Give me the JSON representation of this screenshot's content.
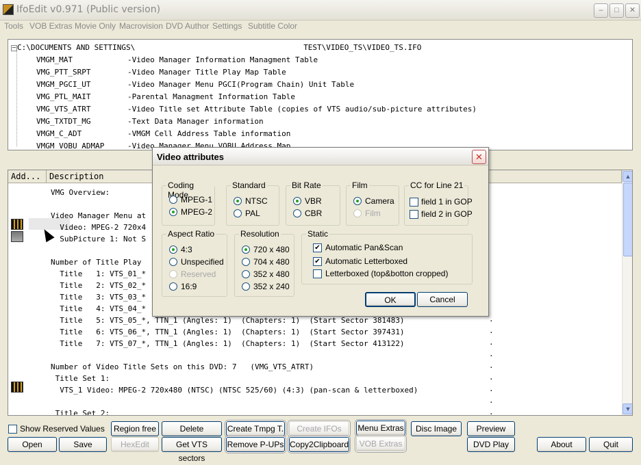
{
  "window": {
    "title": "IfoEdit v0.971 (Public version)"
  },
  "menu": [
    "Tools",
    "VOB Extras",
    "Movie Only",
    "Macrovision",
    "DVD Author",
    "Settings",
    "Subtitle Color"
  ],
  "tree": {
    "root": "C:\\DOCUMENTS AND SETTINGS\\",
    "root_suffix": "TEST\\VIDEO_TS\\VIDEO_TS.IFO",
    "items": [
      {
        "name": "VMGM_MAT",
        "desc": "-Video Manager Information Managment Table"
      },
      {
        "name": "VMG_PTT_SRPT",
        "desc": "-Video Manager Title Play Map Table"
      },
      {
        "name": "VMGM_PGCI_UT",
        "desc": "-Video Manager Menu PGCI(Program Chain) Unit Table"
      },
      {
        "name": "VMG_PTL_MAIT",
        "desc": "-Parental Managment Information Table"
      },
      {
        "name": "VMG_VTS_ATRT",
        "desc": "-Video Title set Attribute Table (copies of VTS audio/sub-picture attributes)"
      },
      {
        "name": "VMG_TXTDT_MG",
        "desc": "-Text Data Manager information"
      },
      {
        "name": "VMGM_C_ADT",
        "desc": "-VMGM Cell Address Table information"
      },
      {
        "name": "VMGM_VOBU_ADMAP",
        "desc": "-Video Manager Menu VOBU Address Map"
      }
    ]
  },
  "list": {
    "columns": [
      "Add...",
      "Description"
    ],
    "lines": [
      "VMG Overview:",
      "",
      "Video Manager Menu at",
      "  Video: MPEG-2 720x4",
      "  SubPicture 1: Not S",
      "",
      "Number of Title Play",
      "  Title   1: VTS_01_*",
      "  Title   2: VTS_02_*",
      "  Title   3: VTS_03_*",
      "  Title   4: VTS_04_*",
      "  Title   5: VTS_05_*, TTN_1 (Angles: 1)  (Chapters: 1)  (Start Sector 381483)",
      "  Title   6: VTS_06_*, TTN_1 (Angles: 1)  (Chapters: 1)  (Start Sector 397431)",
      "  Title   7: VTS_07_*, TTN_1 (Angles: 1)  (Chapters: 1)  (Start Sector 413122)",
      "",
      "Number of Video Title Sets on this DVD: 7   (VMG_VTS_ATRT)",
      " Title Set 1:",
      "  VTS_1 Video: MPEG-2 720x480 (NTSC) (NTSC 525/60) (4:3) (pan-scan & letterboxed)",
      "",
      " Title Set 2:"
    ],
    "dot": "."
  },
  "dialog": {
    "title": "Video attributes",
    "coding_mode": {
      "label": "Coding Mode",
      "options": [
        "MPEG-1",
        "MPEG-2"
      ],
      "selected": "MPEG-2"
    },
    "standard": {
      "label": "Standard",
      "options": [
        "NTSC",
        "PAL"
      ],
      "selected": "NTSC"
    },
    "bit_rate": {
      "label": "Bit Rate",
      "options": [
        "VBR",
        "CBR"
      ],
      "selected": "VBR"
    },
    "film": {
      "label": "Film",
      "options": [
        "Camera",
        "Film"
      ],
      "selected": "Camera"
    },
    "cc": {
      "label": "CC for Line 21",
      "options": [
        "field 1 in GOP",
        "field 2 in GOP"
      ]
    },
    "aspect_ratio": {
      "label": "Aspect Ratio",
      "options": [
        "4:3",
        "Unspecified",
        "Reserved",
        "16:9"
      ],
      "selected": "4:3"
    },
    "resolution": {
      "label": "Resolution",
      "options": [
        "720 x 480",
        "704 x 480",
        "352 x 480",
        "352 x 240"
      ],
      "selected": "720 x 480"
    },
    "static": {
      "label": "Static",
      "options": [
        "Automatic Pan&Scan",
        "Automatic Letterboxed",
        "Letterboxed (top&botton cropped)"
      ],
      "checked": [
        true,
        true,
        false
      ]
    },
    "ok": "OK",
    "cancel": "Cancel"
  },
  "buttons": {
    "show_reserved": "Show Reserved Values",
    "region_free": "Region free",
    "delete_playback": "Delete Playback",
    "create_tmpg": "Create Tmpg T.",
    "create_ifos": "Create IFOs",
    "menu_extras": "Menu Extras",
    "disc_image": "Disc Image",
    "preview": "Preview",
    "open": "Open",
    "save": "Save",
    "hexedit": "HexEdit",
    "get_vts_sectors": "Get VTS sectors",
    "remove_pups": "Remove P-UPs",
    "copy2clipboard": "Copy2Clipboard",
    "vob_extras": "VOB Extras",
    "dvd_play": "DVD Play",
    "about": "About",
    "quit": "Quit"
  }
}
